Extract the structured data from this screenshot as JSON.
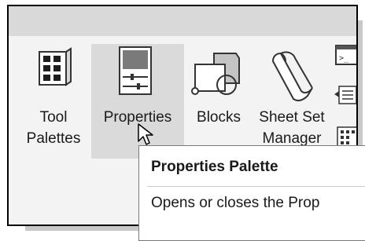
{
  "ribbon": {
    "tools": [
      {
        "id": "tool-palettes",
        "line1": "Tool",
        "line2": "Palettes"
      },
      {
        "id": "properties",
        "line1": "Properties",
        "line2": ""
      },
      {
        "id": "blocks",
        "line1": "Blocks",
        "line2": ""
      },
      {
        "id": "sheet-set-manager",
        "line1": "Sheet Set",
        "line2": "Manager"
      }
    ]
  },
  "tooltip": {
    "title": "Properties Palette",
    "description": "Opens or closes the Prop"
  },
  "colors": {
    "hover": "#dadada",
    "panel": "#f3f3f3",
    "titlebar": "#d9d9d9"
  }
}
